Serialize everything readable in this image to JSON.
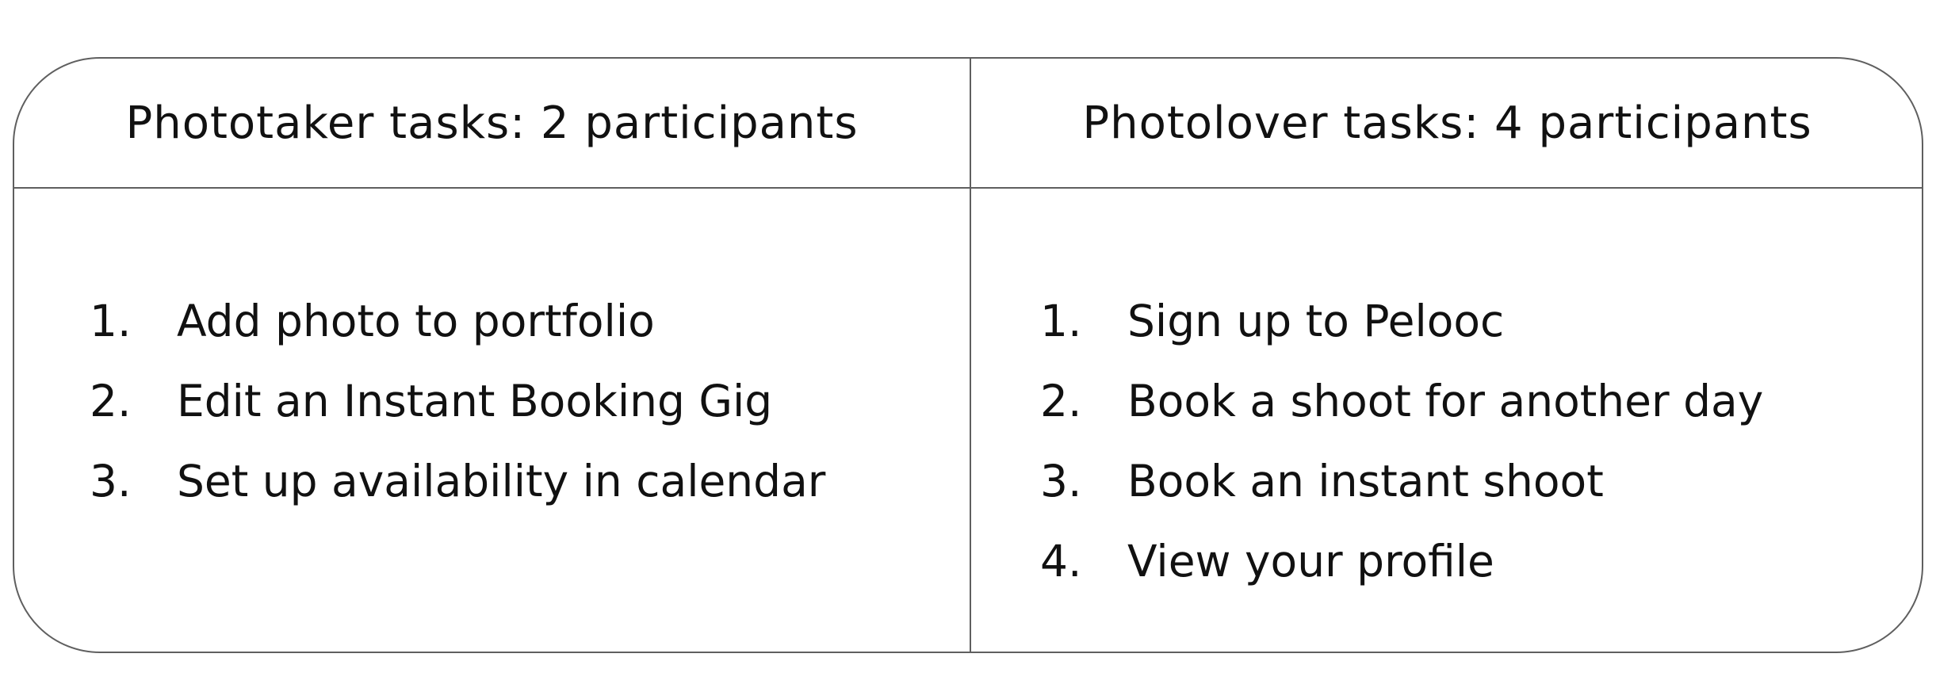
{
  "columns": [
    {
      "header": "Phototaker tasks: 2 participants",
      "tasks": [
        {
          "num": "1.",
          "text": "Add photo to portfolio"
        },
        {
          "num": "2.",
          "text": "Edit an Instant Booking Gig"
        },
        {
          "num": "3.",
          "text": "Set up availability in calendar"
        }
      ]
    },
    {
      "header": "Photolover tasks: 4 participants",
      "tasks": [
        {
          "num": "1.",
          "text": "Sign up to Pelooc"
        },
        {
          "num": "2.",
          "text": "Book a shoot for another day"
        },
        {
          "num": "3.",
          "text": "Book an instant shoot"
        },
        {
          "num": "4.",
          "text": "View your profile"
        }
      ]
    }
  ],
  "colors": {
    "border": "#5f5f5f",
    "text": "#111111",
    "background": "#ffffff"
  }
}
